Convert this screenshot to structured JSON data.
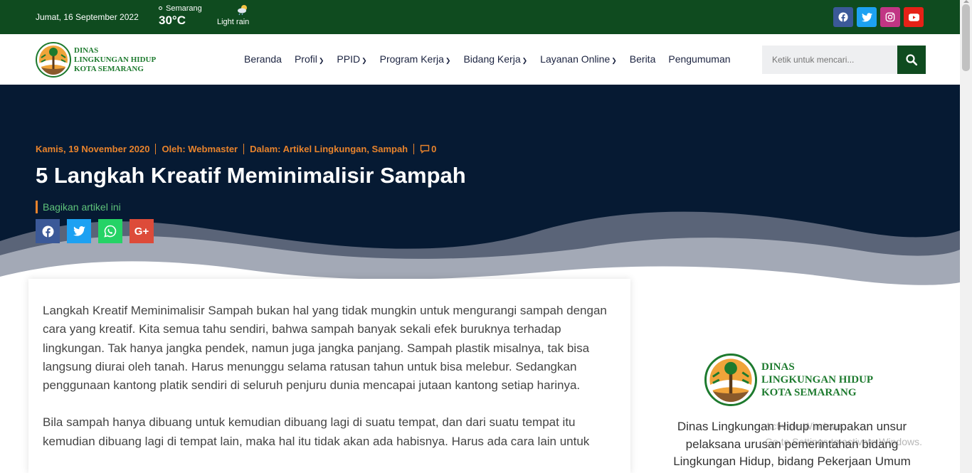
{
  "topbar": {
    "date": "Jumat, 16 September 2022",
    "city": "Semarang",
    "temperature": "30°C",
    "condition": "Light rain",
    "socials": [
      "facebook-icon",
      "twitter-icon",
      "instagram-icon",
      "youtube-icon"
    ]
  },
  "logo": {
    "line1": "DINAS",
    "line2": "LINGKUNGAN HIDUP",
    "line3": "KOTA SEMARANG"
  },
  "menu": {
    "items": [
      "Beranda",
      "Profil",
      "PPID",
      "Program Kerja",
      "Bidang Kerja",
      "Layanan Online",
      "Berita",
      "Pengumuman"
    ]
  },
  "search": {
    "placeholder": "Ketik untuk mencari..."
  },
  "post": {
    "date": "Kamis, 19 November 2020",
    "author": "Oleh: Webmaster",
    "category": "Dalam: Artikel Lingkungan, Sampah",
    "comments": "0",
    "title": "5 Langkah Kreatif Meminimalisir Sampah",
    "share_label": "Bagikan artikel ini",
    "share_icons": [
      "facebook-icon",
      "twitter-icon",
      "whatsapp-icon",
      "google-plus-icon"
    ],
    "share_gplus_glyph": "G+",
    "paragraph1": "Langkah Kreatif Meminimalisir Sampah bukan hal yang tidak mungkin untuk mengurangi sampah dengan cara yang kreatif. Kita semua tahu sendiri, bahwa sampah banyak sekali efek buruknya terhadap lingkungan. Tak hanya jangka pendek, namun juga jangka panjang. Sampah plastik misalnya, tak bisa langsung diurai oleh tanah. Harus menunggu selama ratusan tahun untuk bisa melebur. Sedangkan penggunaan kantong platik sendiri di seluruh penjuru dunia mencapai jutaan kantong setiap harinya.",
    "paragraph2": "Bila sampah hanya dibuang untuk kemudian dibuang lagi di suatu tempat, dan dari suatu tempat itu kemudian dibuang lagi di tempat lain, maka hal itu tidak akan ada habisnya. Harus ada cara lain untuk"
  },
  "sidebar": {
    "logo_line1": "DINAS",
    "logo_line2": "LINGKUNGAN HIDUP",
    "logo_line3": "KOTA SEMARANG",
    "description": "Dinas Lingkungan Hidup merupakan unsur pelaksana urusan pemerintahan bidang Lingkungan Hidup, bidang Pekerjaan Umum"
  },
  "watermark": {
    "line1": "Activate Windows",
    "line2": "Go to Settings to activate Windows."
  },
  "colors": {
    "topbar_bg": "#0f4b1f",
    "hero_bg": "#061a33",
    "accent_orange": "#e8832c",
    "share_green": "#5ec27a",
    "logo_green": "#1d7a2e"
  }
}
